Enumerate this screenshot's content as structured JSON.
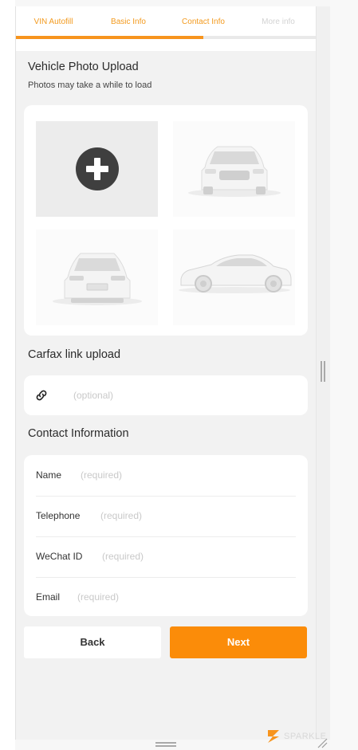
{
  "tabs": [
    {
      "label": "VIN Autofill",
      "state": "done"
    },
    {
      "label": "Basic Info",
      "state": "done"
    },
    {
      "label": "Contact Info",
      "state": "done"
    },
    {
      "label": "More info",
      "state": "todo"
    }
  ],
  "progress_fraction": 0.625,
  "photo_section": {
    "title": "Vehicle Photo Upload",
    "subtitle": "Photos may take a while to load",
    "slots": [
      {
        "type": "add",
        "icon": "add-photo-icon"
      },
      {
        "type": "placeholder",
        "icon": "car-front-silhouette"
      },
      {
        "type": "placeholder",
        "icon": "car-rear-silhouette"
      },
      {
        "type": "placeholder",
        "icon": "car-side-silhouette"
      }
    ]
  },
  "carfax": {
    "title": "Carfax link upload",
    "icon": "link-icon",
    "placeholder": "(optional)"
  },
  "contact": {
    "title": "Contact Information",
    "fields": [
      {
        "label": "Name",
        "placeholder": "(required)"
      },
      {
        "label": "Telephone",
        "placeholder": "(required)"
      },
      {
        "label": "WeChat ID",
        "placeholder": "(required)"
      },
      {
        "label": "Email",
        "placeholder": "(required)"
      }
    ]
  },
  "buttons": {
    "back": "Back",
    "next": "Next"
  },
  "brand": {
    "text": "SPARKLE"
  },
  "colors": {
    "accent": "#f7941d",
    "next_button": "#fb8c09",
    "add_circle": "#3f3f3f"
  }
}
